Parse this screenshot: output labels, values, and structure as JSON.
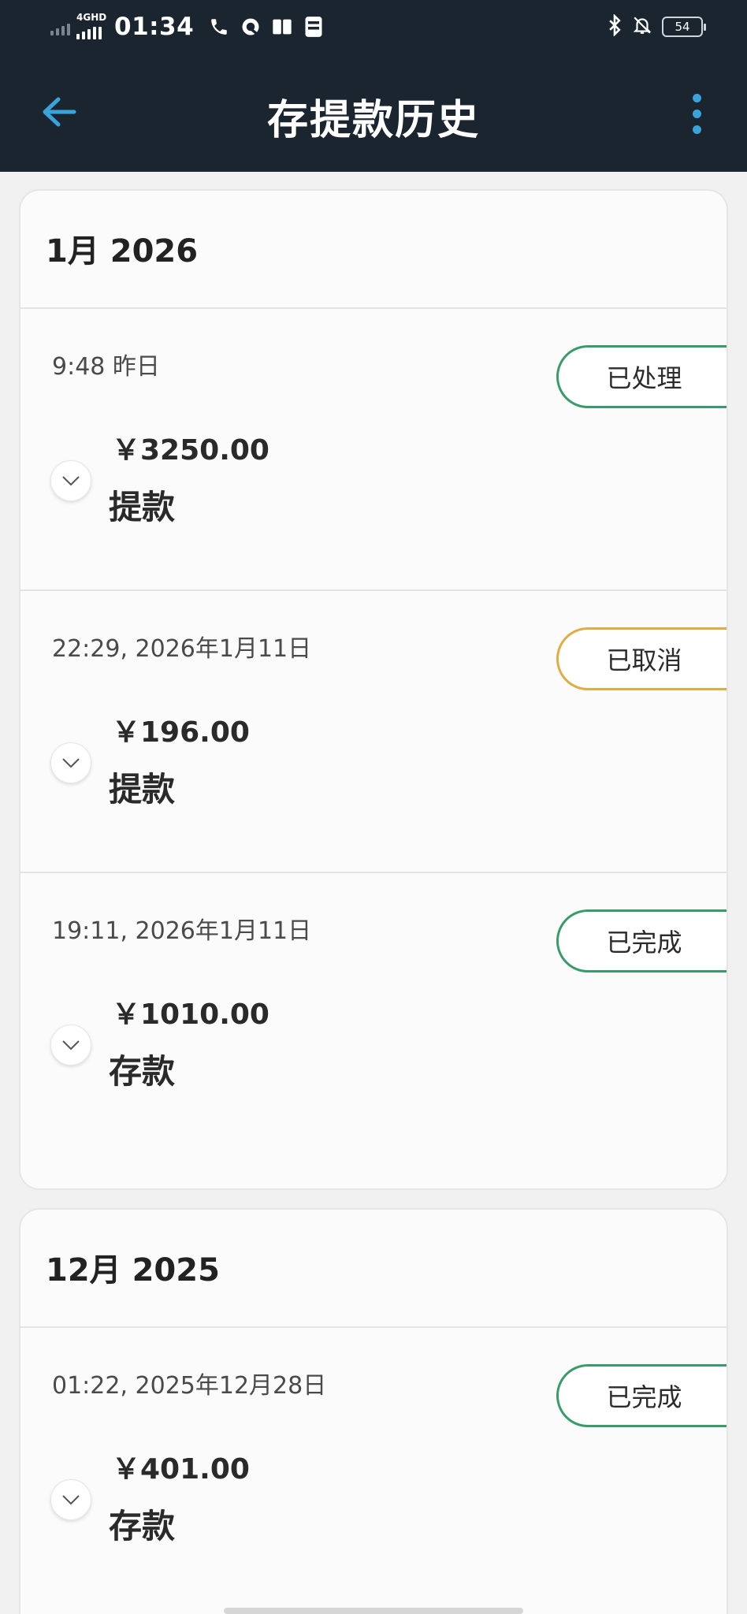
{
  "status_bar": {
    "network_label": "4GHD",
    "time": "01:34",
    "icons_left": [
      "phone-icon",
      "q-app-icon",
      "book-icon",
      "sim-card-icon"
    ],
    "icons_right": [
      "bluetooth-icon",
      "mute-icon"
    ],
    "battery": "54"
  },
  "header": {
    "title": "存提款历史",
    "back_icon": "arrow-left-icon",
    "more_icon": "more-vertical-icon",
    "accent_color": "#3aa3db"
  },
  "months": [
    {
      "title": "1月 2026",
      "transactions": [
        {
          "date": "9:48 昨日",
          "amount": "￥3250.00",
          "type": "提款",
          "status": "已处理",
          "status_color": "#3a9b6a"
        },
        {
          "date": "22:29, 2026年1月11日",
          "amount": "￥196.00",
          "type": "提款",
          "status": "已取消",
          "status_color": "#e0ad45"
        },
        {
          "date": "19:11, 2026年1月11日",
          "amount": "￥1010.00",
          "type": "存款",
          "status": "已完成",
          "status_color": "#3a9b6a"
        }
      ]
    },
    {
      "title": "12月 2025",
      "transactions": [
        {
          "date": "01:22, 2025年12月28日",
          "amount": "￥401.00",
          "type": "存款",
          "status": "已完成",
          "status_color": "#3a9b6a"
        }
      ]
    }
  ]
}
